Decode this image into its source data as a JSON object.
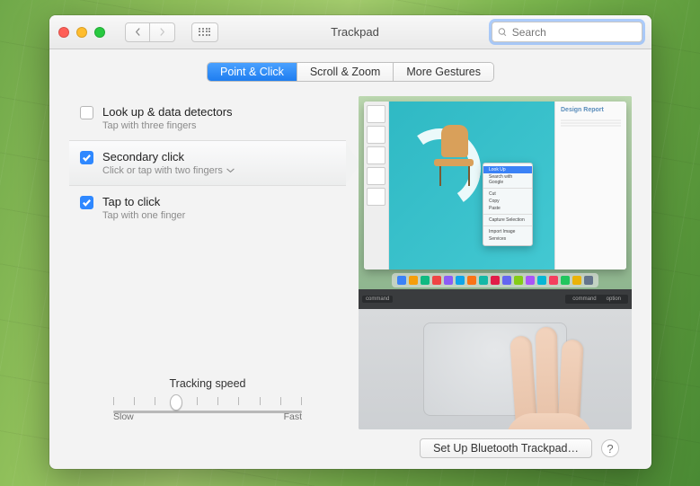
{
  "window": {
    "title": "Trackpad"
  },
  "search": {
    "placeholder": "Search"
  },
  "tabs": [
    {
      "label": "Point & Click",
      "active": true
    },
    {
      "label": "Scroll & Zoom",
      "active": false
    },
    {
      "label": "More Gestures",
      "active": false
    }
  ],
  "options": [
    {
      "title": "Look up & data detectors",
      "sub": "Tap with three fingers",
      "checked": false,
      "selected": false,
      "dropdown": false
    },
    {
      "title": "Secondary click",
      "sub": "Click or tap with two fingers",
      "checked": true,
      "selected": true,
      "dropdown": true
    },
    {
      "title": "Tap to click",
      "sub": "Tap with one finger",
      "checked": true,
      "selected": false,
      "dropdown": false
    }
  ],
  "tracking": {
    "label": "Tracking speed",
    "min_label": "Slow",
    "max_label": "Fast",
    "ticks": 10,
    "value_index": 3
  },
  "footer": {
    "setup_label": "Set Up Bluetooth Trackpad…",
    "help_label": "?"
  },
  "preview": {
    "side_header": "Design Report",
    "context_menu": [
      "Look Up",
      "Search with Google",
      "",
      "Cut",
      "Copy",
      "Paste",
      "",
      "Capture Selection",
      "",
      "Import Image",
      "Services"
    ],
    "key_left": "command",
    "key_right1": "command",
    "key_right2": "option",
    "dock_colors": [
      "#3b82f6",
      "#f59e0b",
      "#10b981",
      "#ef4444",
      "#8b5cf6",
      "#0ea5e9",
      "#f97316",
      "#14b8a6",
      "#e11d48",
      "#6366f1",
      "#84cc16",
      "#a855f7",
      "#06b6d4",
      "#f43f5e",
      "#22c55e",
      "#eab308",
      "#64748b"
    ]
  }
}
